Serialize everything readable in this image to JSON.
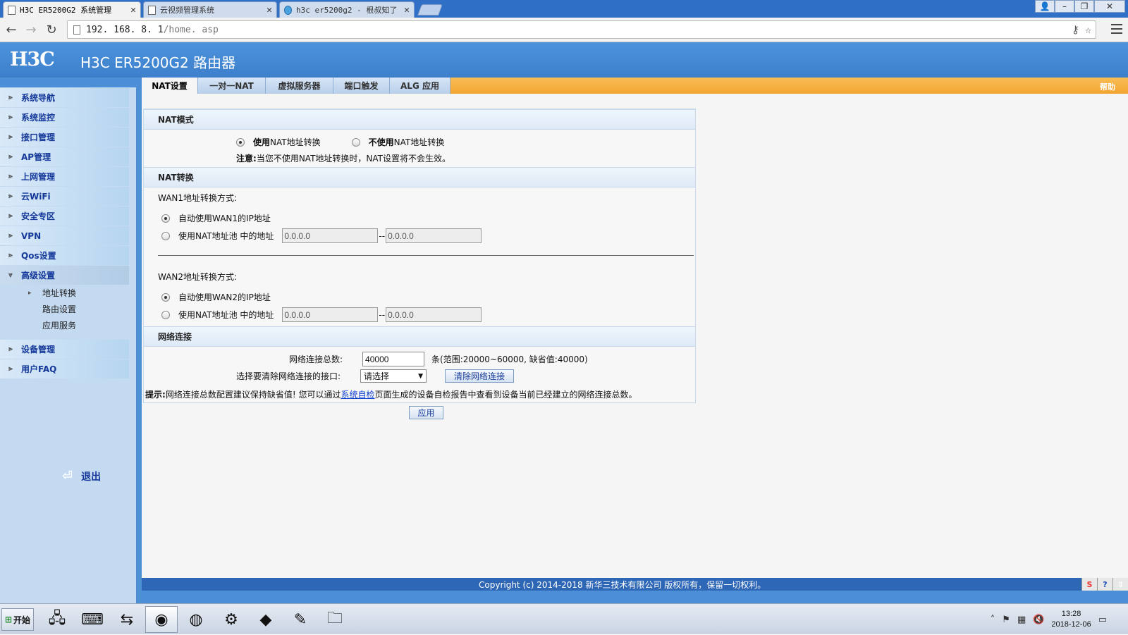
{
  "browser": {
    "tabs": [
      {
        "title": "H3C  ER5200G2  系统管理"
      },
      {
        "title": "云视频管理系统"
      },
      {
        "title": "h3c er5200g2 - 根叔知了"
      }
    ],
    "url_host": "192. 168. 8. 1",
    "url_path": "/home. asp"
  },
  "header": {
    "logo": "H3C",
    "title": "H3C ER5200G2 路由器"
  },
  "sidebar": {
    "items": [
      {
        "label": "系统导航"
      },
      {
        "label": "系统监控"
      },
      {
        "label": "接口管理"
      },
      {
        "label": "AP管理"
      },
      {
        "label": "上网管理"
      },
      {
        "label": "云WiFi"
      },
      {
        "label": "安全专区"
      },
      {
        "label": "VPN"
      },
      {
        "label": "Qos设置"
      },
      {
        "label": "高级设置"
      }
    ],
    "sub_items": [
      {
        "label": "地址转换"
      },
      {
        "label": "路由设置"
      },
      {
        "label": "应用服务"
      }
    ],
    "items_after": [
      {
        "label": "设备管理"
      },
      {
        "label": "用户FAQ"
      }
    ],
    "logout": "退出"
  },
  "tabs": [
    {
      "label": "NAT设置"
    },
    {
      "label": "一对一NAT"
    },
    {
      "label": "虚拟服务器"
    },
    {
      "label": "端口触发"
    },
    {
      "label": "ALG 应用"
    }
  ],
  "help": "帮助",
  "nat_mode": {
    "heading": "NAT模式",
    "use_bold": "使用",
    "use_rest": " NAT地址转换",
    "nouse_bold": "不使用",
    "nouse_rest": " NAT地址转换",
    "note_bold": "注意:",
    "note_text": "当您不使用NAT地址转换时，NAT设置将不会生效。"
  },
  "nat_conv": {
    "heading": "NAT转换",
    "wan1_label": "WAN1地址转换方式:",
    "wan1_auto": "自动使用WAN1的IP地址",
    "wan1_pool": "使用NAT地址池 中的地址",
    "wan1_start": "0.0.0.0",
    "wan1_end": "0.0.0.0",
    "wan2_label": "WAN2地址转换方式:",
    "wan2_auto": "自动使用WAN2的IP地址",
    "wan2_pool": "使用NAT地址池 中的地址",
    "wan2_start": "0.0.0.0",
    "wan2_end": "0.0.0.0",
    "dash": "--"
  },
  "net_conn": {
    "heading": "网络连接",
    "total_label": "网络连接总数:",
    "total_value": "40000",
    "total_hint": "条(范围:20000~60000, 缺省值:40000)",
    "iface_label": "选择要清除网络连接的接口:",
    "iface_value": "请选择",
    "clear_button": "清除网络连接",
    "tip_bold": "提示:",
    "tip_before": "网络连接总数配置建议保持缺省值! 您可以通过",
    "tip_link": "系统自检",
    "tip_after": "页面生成的设备自检报告中查看到设备当前已经建立的网络连接总数。"
  },
  "apply_button": "应用",
  "footer": "Copyright (c) 2014-2018 新华三技术有限公司 版权所有，保留一切权利。",
  "taskbar": {
    "start": "开始",
    "time": "13:28",
    "date": "2018-12-06"
  }
}
